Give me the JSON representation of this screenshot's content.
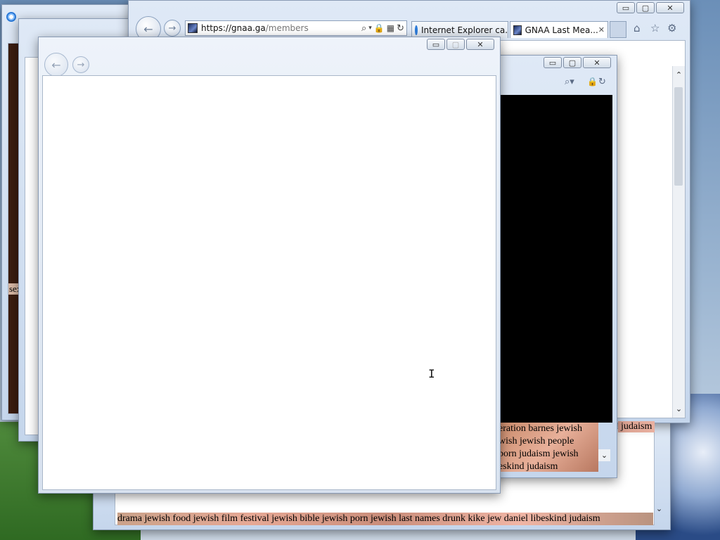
{
  "main_window": {
    "address_domain": "https://gnaa.ga",
    "address_path": "/members",
    "tabs": [
      {
        "label": "Internet Explorer ca..."
      },
      {
        "label": "GNAA Last Mea...",
        "close": "✕"
      }
    ]
  },
  "bottom_strip_text": "drama jewish food jewish film festival jewish bible jewish porn jewish last names drunk kike jew daniel libeskind judaism",
  "right_window": {
    "lines": [
      "eration barnes jewish",
      "wish jewish people",
      "porn judaism jewish",
      "eskind judaism"
    ]
  },
  "far_right_text": "judaism",
  "left_edge_text": "sex",
  "caption": {
    "minimize": "▭",
    "maximize": "▢",
    "close": "✕"
  },
  "colors": {
    "black_content": "#000000",
    "title_frame": "#dfe9f6"
  }
}
